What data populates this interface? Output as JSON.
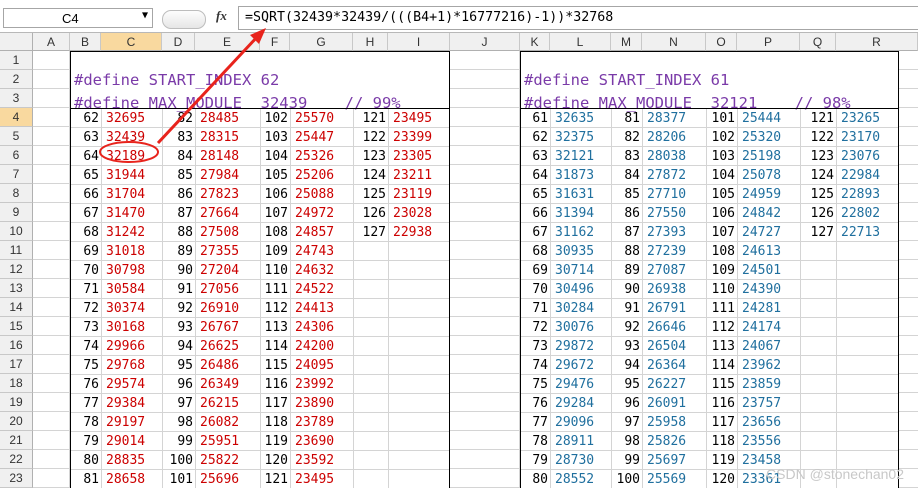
{
  "formula_bar": {
    "name_box": "C4",
    "fx": "fx",
    "formula": "=SQRT(32439*32439/(((B4+1)*16777216)-1))*32768"
  },
  "columns": [
    "A",
    "B",
    "C",
    "D",
    "E",
    "F",
    "G",
    "H",
    "I",
    "J",
    "K",
    "L",
    "M",
    "N",
    "O",
    "P",
    "Q",
    "R"
  ],
  "rows": [
    "1",
    "2",
    "3",
    "4",
    "5",
    "6",
    "7",
    "8",
    "9",
    "10",
    "11",
    "12",
    "13",
    "14",
    "15",
    "16",
    "17",
    "18",
    "19",
    "20",
    "21",
    "22",
    "23",
    "24"
  ],
  "left_table": {
    "line1": "#define START_INDEX 62",
    "line2": "#define MAX_MODULE  32439    // 99%",
    "col1": [
      [
        "62",
        "32695"
      ],
      [
        "63",
        "32439"
      ],
      [
        "64",
        "32189"
      ],
      [
        "65",
        "31944"
      ],
      [
        "66",
        "31704"
      ],
      [
        "67",
        "31470"
      ],
      [
        "68",
        "31242"
      ],
      [
        "69",
        "31018"
      ],
      [
        "70",
        "30798"
      ],
      [
        "71",
        "30584"
      ],
      [
        "72",
        "30374"
      ],
      [
        "73",
        "30168"
      ],
      [
        "74",
        "29966"
      ],
      [
        "75",
        "29768"
      ],
      [
        "76",
        "29574"
      ],
      [
        "77",
        "29384"
      ],
      [
        "78",
        "29197"
      ],
      [
        "79",
        "29014"
      ],
      [
        "80",
        "28835"
      ],
      [
        "81",
        "28658"
      ]
    ],
    "col2": [
      [
        "82",
        "28485"
      ],
      [
        "83",
        "28315"
      ],
      [
        "84",
        "28148"
      ],
      [
        "85",
        "27984"
      ],
      [
        "86",
        "27823"
      ],
      [
        "87",
        "27664"
      ],
      [
        "88",
        "27508"
      ],
      [
        "89",
        "27355"
      ],
      [
        "90",
        "27204"
      ],
      [
        "91",
        "27056"
      ],
      [
        "92",
        "26910"
      ],
      [
        "93",
        "26767"
      ],
      [
        "94",
        "26625"
      ],
      [
        "95",
        "26486"
      ],
      [
        "96",
        "26349"
      ],
      [
        "97",
        "26215"
      ],
      [
        "98",
        "26082"
      ],
      [
        "99",
        "25951"
      ],
      [
        "100",
        "25822"
      ],
      [
        "101",
        "25696"
      ]
    ],
    "col3": [
      [
        "102",
        "25570"
      ],
      [
        "103",
        "25447"
      ],
      [
        "104",
        "25326"
      ],
      [
        "105",
        "25206"
      ],
      [
        "106",
        "25088"
      ],
      [
        "107",
        "24972"
      ],
      [
        "108",
        "24857"
      ],
      [
        "109",
        "24743"
      ],
      [
        "110",
        "24632"
      ],
      [
        "111",
        "24522"
      ],
      [
        "112",
        "24413"
      ],
      [
        "113",
        "24306"
      ],
      [
        "114",
        "24200"
      ],
      [
        "115",
        "24095"
      ],
      [
        "116",
        "23992"
      ],
      [
        "117",
        "23890"
      ],
      [
        "118",
        "23789"
      ],
      [
        "119",
        "23690"
      ],
      [
        "120",
        "23592"
      ],
      [
        "121",
        "23495"
      ]
    ],
    "col4": [
      [
        "121",
        "23495"
      ],
      [
        "122",
        "23399"
      ],
      [
        "123",
        "23305"
      ],
      [
        "124",
        "23211"
      ],
      [
        "125",
        "23119"
      ],
      [
        "126",
        "23028"
      ],
      [
        "127",
        "22938"
      ]
    ]
  },
  "right_table": {
    "line1": "#define START_INDEX 61",
    "line2": "#define MAX_MODULE  32121    // 98%",
    "col1": [
      [
        "61",
        "32635"
      ],
      [
        "62",
        "32375"
      ],
      [
        "63",
        "32121"
      ],
      [
        "64",
        "31873"
      ],
      [
        "65",
        "31631"
      ],
      [
        "66",
        "31394"
      ],
      [
        "67",
        "31162"
      ],
      [
        "68",
        "30935"
      ],
      [
        "69",
        "30714"
      ],
      [
        "70",
        "30496"
      ],
      [
        "71",
        "30284"
      ],
      [
        "72",
        "30076"
      ],
      [
        "73",
        "29872"
      ],
      [
        "74",
        "29672"
      ],
      [
        "75",
        "29476"
      ],
      [
        "76",
        "29284"
      ],
      [
        "77",
        "29096"
      ],
      [
        "78",
        "28911"
      ],
      [
        "79",
        "28730"
      ],
      [
        "80",
        "28552"
      ]
    ],
    "col2": [
      [
        "81",
        "28377"
      ],
      [
        "82",
        "28206"
      ],
      [
        "83",
        "28038"
      ],
      [
        "84",
        "27872"
      ],
      [
        "85",
        "27710"
      ],
      [
        "86",
        "27550"
      ],
      [
        "87",
        "27393"
      ],
      [
        "88",
        "27239"
      ],
      [
        "89",
        "27087"
      ],
      [
        "90",
        "26938"
      ],
      [
        "91",
        "26791"
      ],
      [
        "92",
        "26646"
      ],
      [
        "93",
        "26504"
      ],
      [
        "94",
        "26364"
      ],
      [
        "95",
        "26227"
      ],
      [
        "96",
        "26091"
      ],
      [
        "97",
        "25958"
      ],
      [
        "98",
        "25826"
      ],
      [
        "99",
        "25697"
      ],
      [
        "100",
        "25569"
      ]
    ],
    "col3": [
      [
        "101",
        "25444"
      ],
      [
        "102",
        "25320"
      ],
      [
        "103",
        "25198"
      ],
      [
        "104",
        "25078"
      ],
      [
        "105",
        "24959"
      ],
      [
        "106",
        "24842"
      ],
      [
        "107",
        "24727"
      ],
      [
        "108",
        "24613"
      ],
      [
        "109",
        "24501"
      ],
      [
        "110",
        "24390"
      ],
      [
        "111",
        "24281"
      ],
      [
        "112",
        "24174"
      ],
      [
        "113",
        "24067"
      ],
      [
        "114",
        "23962"
      ],
      [
        "115",
        "23859"
      ],
      [
        "116",
        "23757"
      ],
      [
        "117",
        "23656"
      ],
      [
        "118",
        "23556"
      ],
      [
        "119",
        "23458"
      ],
      [
        "120",
        "23361"
      ]
    ],
    "col4": [
      [
        "121",
        "23265"
      ],
      [
        "122",
        "23170"
      ],
      [
        "123",
        "23076"
      ],
      [
        "124",
        "22984"
      ],
      [
        "125",
        "22893"
      ],
      [
        "126",
        "22802"
      ],
      [
        "127",
        "22713"
      ]
    ]
  },
  "colors": {
    "left_values": "#cc0000",
    "right_values": "#1f6f9e",
    "define_text": "#7a3aa8",
    "annotation": "#e8231c",
    "selected_header": "#f9d99f"
  },
  "watermark": "CSDN @stonechan02"
}
